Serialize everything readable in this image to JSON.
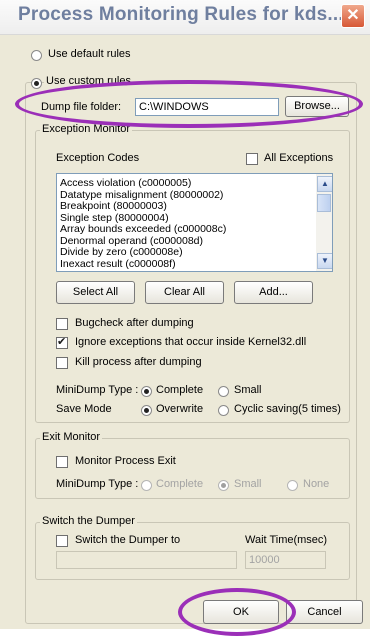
{
  "window": {
    "title": "Process Monitoring Rules for kds...",
    "close_glyph": "✕"
  },
  "rules": {
    "default_label": "Use default rules",
    "custom_label": "Use custom rules",
    "selected": "custom"
  },
  "dump": {
    "label": "Dump file folder:",
    "value": "C:\\WINDOWS",
    "browse_label": "Browse..."
  },
  "exception_monitor": {
    "group_label": "Exception Monitor",
    "codes_label": "Exception Codes",
    "all_exceptions_label": "All Exceptions",
    "all_exceptions_checked": false,
    "codes": [
      "Access violation (c0000005)",
      "Datatype misalignment (80000002)",
      "Breakpoint (80000003)",
      "Single step (80000004)",
      "Array bounds exceeded (c000008c)",
      "Denormal operand (c000008d)",
      "Divide by zero (c000008e)",
      "Inexact result (c000008f)"
    ],
    "select_all_label": "Select All",
    "clear_all_label": "Clear All",
    "add_label": "Add...",
    "bugcheck_label": "Bugcheck after dumping",
    "bugcheck_checked": false,
    "ignore_label": "Ignore exceptions that occur inside Kernel32.dll",
    "ignore_checked": true,
    "kill_label": "Kill process after dumping",
    "kill_checked": false,
    "minidump_label": "MiniDump Type :",
    "minidump_complete": "Complete",
    "minidump_small": "Small",
    "minidump_selected": "Complete",
    "savemode_label": "Save Mode",
    "savemode_overwrite": "Overwrite",
    "savemode_cyclic": "Cyclic saving(5 times)",
    "savemode_selected": "Overwrite"
  },
  "exit_monitor": {
    "group_label": "Exit Monitor",
    "monitor_label": "Monitor Process Exit",
    "monitor_checked": false,
    "minidump_label": "MiniDump Type :",
    "complete": "Complete",
    "small": "Small",
    "none": "None",
    "selected": "Small"
  },
  "switch_dumper": {
    "group_label": "Switch the Dumper",
    "checkbox_label": "Switch the Dumper to",
    "checked": false,
    "wait_label": "Wait Time(msec)",
    "path_value": "",
    "wait_value": "10000"
  },
  "footer": {
    "ok_label": "OK",
    "cancel_label": "Cancel"
  },
  "colors": {
    "highlight_circle": "#9b2fb8",
    "dialog_bg": "#ece9d8",
    "title_text": "#6f7f9f"
  },
  "icons": {
    "check": "✔",
    "scroll_up": "▲",
    "scroll_down": "▼"
  }
}
